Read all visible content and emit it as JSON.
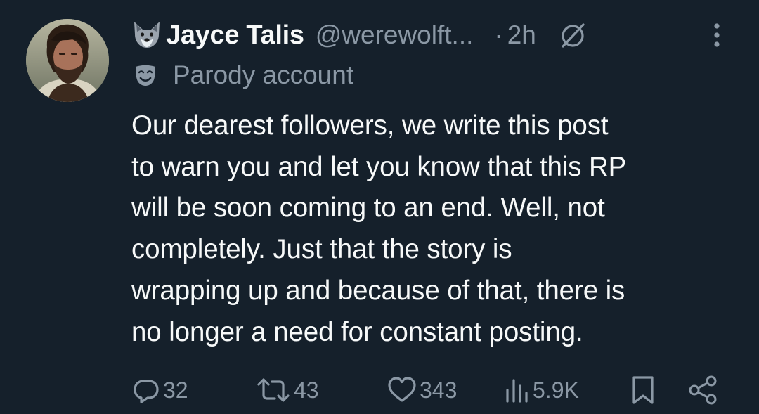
{
  "post": {
    "author": {
      "display_name": "Jayce Talis",
      "handle": "@werewolft...",
      "badge_icon": "wolf-face-emoji-icon",
      "avatar": "profile-avatar"
    },
    "dot": "·",
    "timestamp": "2h",
    "label": {
      "icon": "theater-mask-icon",
      "text": "Parody account"
    },
    "text": "Our dearest followers, we write this post\nto warn you and let you know that this RP\nwill be soon coming to an end. Well, not\ncompletely. Just that the story is\nwrapping up and because of that, there is\nno longer a  need for constant posting.",
    "actions": {
      "replies": "32",
      "reposts": "43",
      "likes": "343",
      "views": "5.9K"
    }
  },
  "colors": {
    "background": "#15202b",
    "primary_text": "#f7f9f9",
    "secondary_text": "#8b98a5"
  }
}
